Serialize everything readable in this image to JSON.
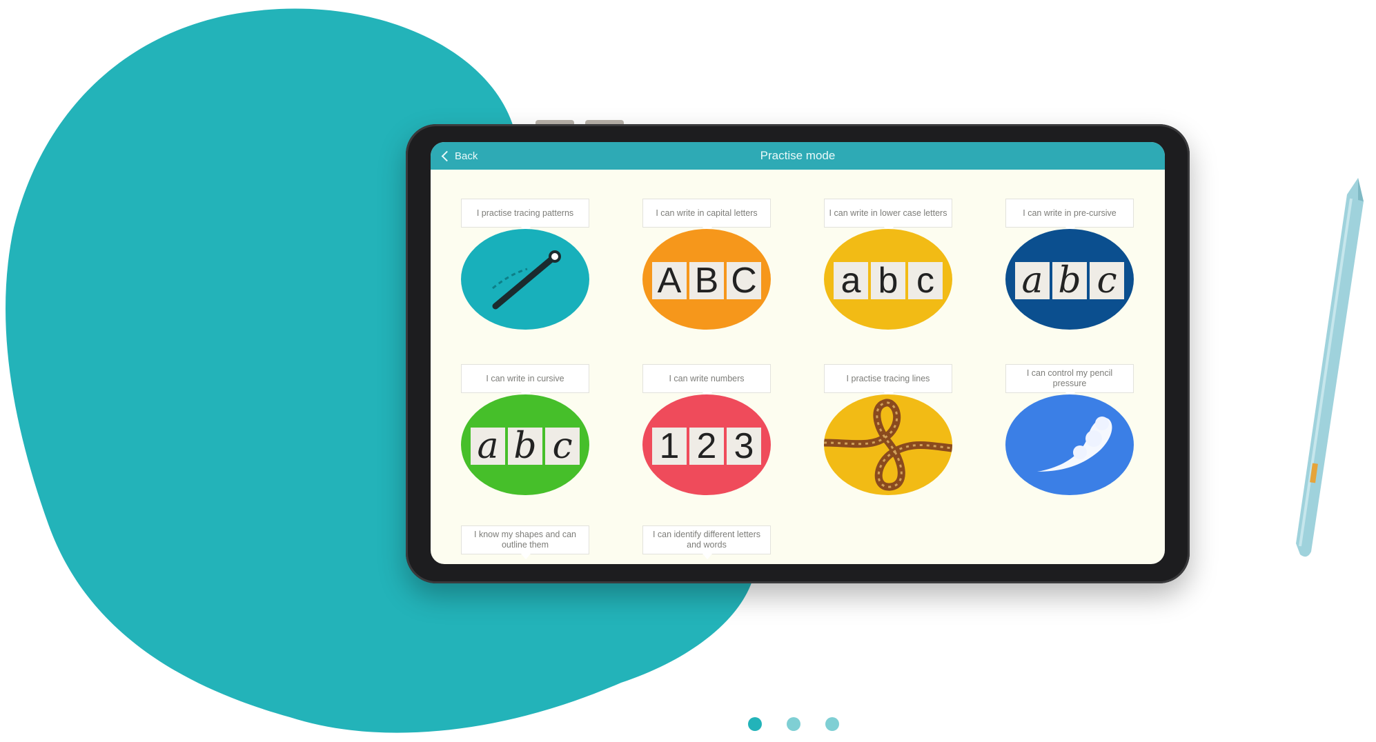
{
  "colors": {
    "teal_blob": "#23b3b9",
    "app_bar": "#2eaab5",
    "screen_bg": "#fdfdf0",
    "stylus": "#9fd2dc"
  },
  "app": {
    "back_label": "Back",
    "title": "Practise mode"
  },
  "tiles": [
    {
      "label": "I practise tracing patterns",
      "color": "#18b0bb",
      "icon": "wand-tracing-icon"
    },
    {
      "label": "I can write in capital letters",
      "color": "#f6971b",
      "icon": "capital-letters-icon",
      "glyphs": [
        "A",
        "B",
        "C"
      ]
    },
    {
      "label": "I can write in lower case letters",
      "color": "#f2bb15",
      "icon": "lowercase-letters-icon",
      "glyphs": [
        "a",
        "b",
        "c"
      ]
    },
    {
      "label": "I can write in pre-cursive",
      "color": "#0b4f8f",
      "icon": "precursive-letters-icon",
      "glyphs": [
        "a",
        "b",
        "c"
      ]
    },
    {
      "label": "I can write in cursive",
      "color": "#46bf2a",
      "icon": "cursive-letters-icon",
      "glyphs": [
        "a",
        "b",
        "c"
      ]
    },
    {
      "label": "I can write numbers",
      "color": "#ef4b5b",
      "icon": "numbers-icon",
      "glyphs": [
        "1",
        "2",
        "3"
      ]
    },
    {
      "label": "I practise tracing lines",
      "color": "#f2bb15",
      "icon": "tracing-lines-icon"
    },
    {
      "label": "I can control my pencil pressure",
      "color": "#3b7fe6",
      "icon": "pencil-pressure-icon"
    },
    {
      "label": "I know my shapes and can outline them"
    },
    {
      "label": "I can identify different letters and words"
    }
  ],
  "pagination": {
    "count": 3,
    "active_index": 0,
    "active_color": "#23b3b9",
    "inactive_color": "#7fcfd4"
  }
}
